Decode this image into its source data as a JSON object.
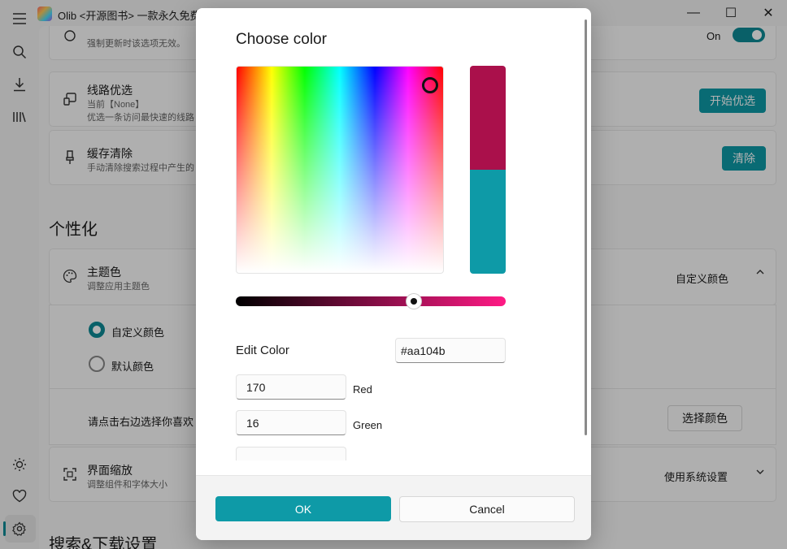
{
  "app": {
    "title": "Olib <开源图书> 一款永久免费",
    "icons": [
      "hamburger-icon",
      "search-icon",
      "download-icon",
      "library-icon",
      "sun-icon",
      "heart-icon",
      "gear-icon"
    ]
  },
  "window": {
    "minimize": "—",
    "maximize": "☐",
    "close": "✕"
  },
  "settings": {
    "top_card": {
      "sub": "强制更新时该选项无效。",
      "toggle_label": "On"
    },
    "route": {
      "title": "线路优选",
      "sub1": "当前【None】",
      "sub2": "优选一条访问最快速的线路",
      "button": "开始优选"
    },
    "cache": {
      "title": "缓存清除",
      "sub": "手动清除搜索过程中产生的",
      "button": "清除"
    },
    "personalization_heading": "个性化",
    "theme": {
      "title": "主题色",
      "sub": "调整应用主题色",
      "value": "自定义颜色",
      "options": [
        "自定义颜色",
        "默认颜色"
      ],
      "pick_hint": "请点击右边选择你喜欢",
      "pick_button": "选择颜色"
    },
    "zoom": {
      "title": "界面缩放",
      "sub": "调整组件和字体大小",
      "value": "使用系统设置"
    },
    "next_heading": "搜索&下载设置"
  },
  "dialog": {
    "title": "Choose color",
    "edit_label": "Edit Color",
    "hex_value": "#aa104b",
    "red_value": "170",
    "red_label": "Red",
    "green_value": "16",
    "green_label": "Green",
    "ok": "OK",
    "cancel": "Cancel"
  },
  "colors": {
    "accent": "#0e9aa7",
    "new_color": "#aa104b",
    "old_color": "#0e9aa7"
  }
}
